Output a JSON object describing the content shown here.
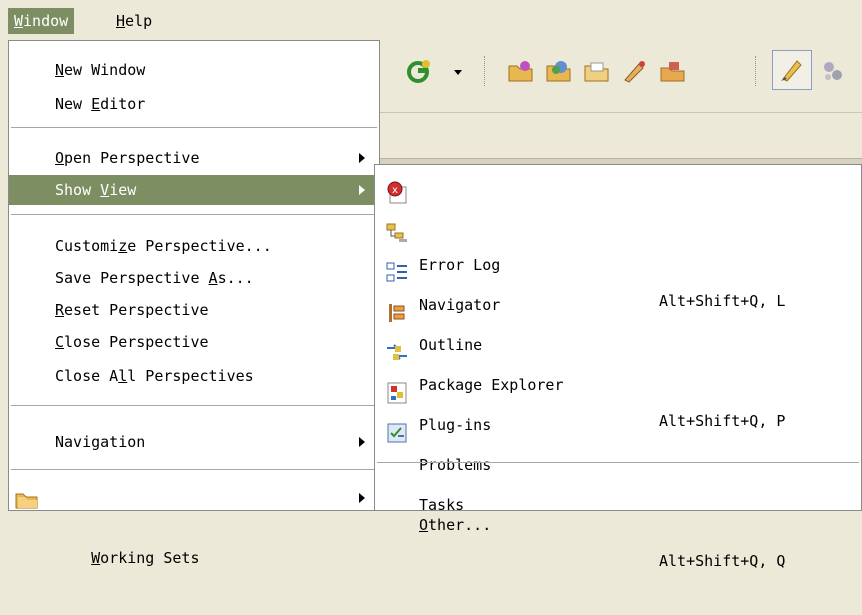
{
  "menubar": {
    "window": {
      "accel": "W",
      "rest": "indow"
    },
    "help": {
      "accel": "H",
      "rest": "elp"
    }
  },
  "window_menu": {
    "items": [
      {
        "pre": "",
        "accel": "N",
        "post": "ew Window"
      },
      {
        "pre": "New ",
        "accel": "E",
        "post": "ditor"
      },
      {
        "pre": "",
        "accel": "O",
        "post": "pen Perspective"
      },
      {
        "pre": "Show ",
        "accel": "V",
        "post": "iew"
      },
      {
        "pre": "Customi",
        "accel": "z",
        "post": "e Perspective..."
      },
      {
        "pre": "Save Perspective ",
        "accel": "A",
        "post": "s..."
      },
      {
        "pre": "",
        "accel": "R",
        "post": "eset Perspective"
      },
      {
        "pre": "",
        "accel": "C",
        "post": "lose Perspective"
      },
      {
        "pre": "Close A",
        "accel": "l",
        "post": "l Perspectives"
      },
      {
        "pre": "Navigation",
        "accel": "",
        "post": ""
      },
      {
        "pre": "",
        "accel": "W",
        "post": "orking Sets"
      }
    ]
  },
  "show_view_menu": {
    "items": [
      {
        "label": "Error Log",
        "shortcut": "Alt+Shift+Q, L",
        "icon": "error-log-icon"
      },
      {
        "label": "Navigator",
        "shortcut": "",
        "icon": "navigator-icon"
      },
      {
        "label": "Outline",
        "shortcut": "",
        "icon": "outline-icon"
      },
      {
        "label": "Package Explorer",
        "shortcut": "Alt+Shift+Q, P",
        "icon": "package-explorer-icon"
      },
      {
        "label": "Plug-ins",
        "shortcut": "",
        "icon": "plugins-icon"
      },
      {
        "label": "Problems",
        "shortcut": "",
        "icon": "problems-icon"
      },
      {
        "label": "Tasks",
        "shortcut": "",
        "icon": "tasks-icon"
      }
    ],
    "other": {
      "accel": "O",
      "rest": "ther...",
      "shortcut": "Alt+Shift+Q, Q"
    }
  },
  "colors": {
    "highlight": "#7d8f62",
    "menu_bg": "#ffffff",
    "chrome_bg": "#ece9d8"
  }
}
